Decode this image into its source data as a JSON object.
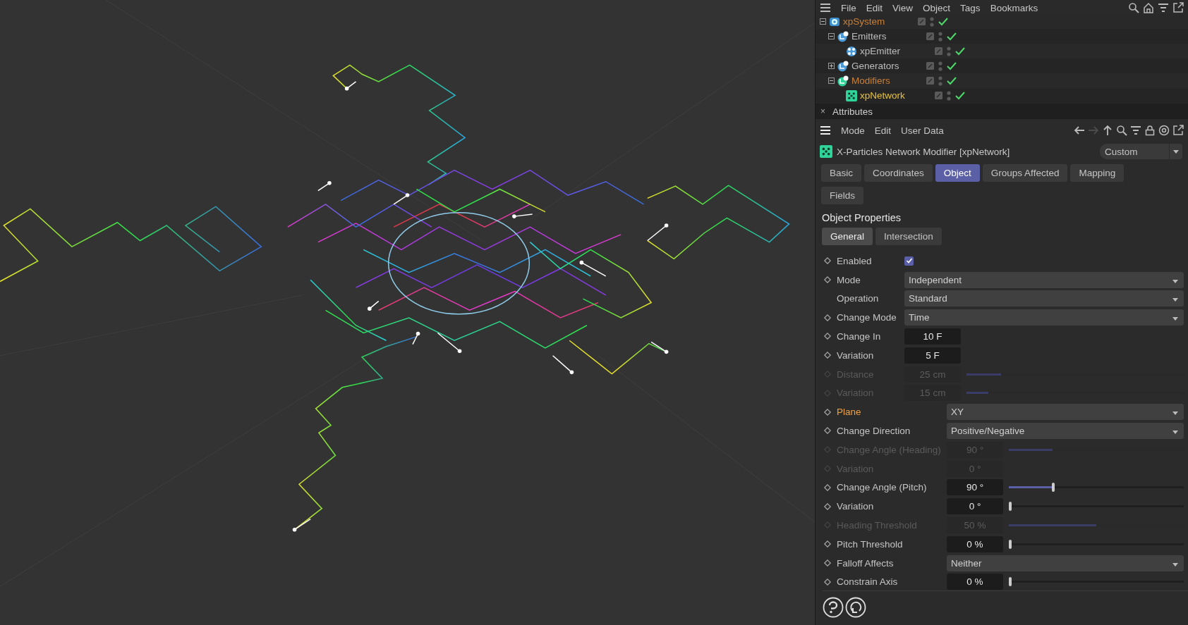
{
  "object_manager": {
    "menu": [
      "File",
      "Edit",
      "View",
      "Object",
      "Tags",
      "Bookmarks"
    ],
    "tree": [
      {
        "name": "xpSystem",
        "kind": "system",
        "color": "#c8803a",
        "expanded": true,
        "enabled": true,
        "children": [
          {
            "name": "Emitters",
            "kind": "group",
            "color": "#bdbdbd",
            "expanded": true,
            "enabled": true,
            "children": [
              {
                "name": "xpEmitter",
                "kind": "emitter",
                "color": "#bdbdbd",
                "enabled": true
              }
            ]
          },
          {
            "name": "Generators",
            "kind": "group",
            "color": "#bdbdbd",
            "expanded": false,
            "enabled": true
          },
          {
            "name": "Modifiers",
            "kind": "group-active",
            "color": "#c8803a",
            "expanded": true,
            "enabled": true,
            "children": [
              {
                "name": "xpNetwork",
                "kind": "network",
                "color": "#e8c23c",
                "enabled": true
              }
            ]
          }
        ]
      }
    ]
  },
  "attributes": {
    "close": "×",
    "title": "Attributes",
    "menu": [
      "Mode",
      "Edit",
      "User Data"
    ],
    "object_title": "X-Particles Network Modifier [xpNetwork]",
    "preset": "Custom",
    "tabs": [
      {
        "label": "Basic",
        "selected": false
      },
      {
        "label": "Coordinates",
        "selected": false
      },
      {
        "label": "Object",
        "selected": true
      },
      {
        "label": "Groups Affected",
        "selected": false
      },
      {
        "label": "Mapping",
        "selected": false
      },
      {
        "label": "Fields",
        "selected": false
      }
    ],
    "section": "Object Properties",
    "subtabs": [
      {
        "label": "General",
        "selected": true
      },
      {
        "label": "Intersection",
        "selected": false
      }
    ],
    "groups": [
      {
        "params": [
          {
            "label": "Enabled",
            "kind": "checkbox",
            "checked": true,
            "keyframe": true,
            "disabled": false,
            "modified": false
          },
          {
            "label": "Mode",
            "kind": "dropdown",
            "value": "Independent",
            "keyframe": true,
            "disabled": false,
            "modified": false
          },
          {
            "label": "Operation",
            "kind": "dropdown",
            "value": "Standard",
            "keyframe": false,
            "disabled": false,
            "modified": false
          },
          {
            "label": "Change Mode",
            "kind": "dropdown",
            "value": "Time",
            "keyframe": true,
            "disabled": false,
            "modified": false
          },
          {
            "label": "Change In",
            "kind": "number",
            "value": "10 F",
            "keyframe": true,
            "disabled": false,
            "modified": false
          },
          {
            "label": "Variation",
            "kind": "number",
            "value": "5 F",
            "keyframe": true,
            "disabled": false,
            "modified": false
          },
          {
            "label": "Distance",
            "kind": "slider",
            "value": "25 cm",
            "level": 0.16,
            "keyframe": true,
            "disabled": true,
            "modified": false
          },
          {
            "label": "Variation",
            "kind": "slider",
            "value": "15 cm",
            "level": 0.1,
            "keyframe": true,
            "disabled": true,
            "modified": false
          }
        ]
      },
      {
        "params": [
          {
            "label": "Plane",
            "kind": "dropdown",
            "value": "XY",
            "keyframe": true,
            "disabled": false,
            "modified": true
          },
          {
            "label": "Change Direction",
            "kind": "dropdown",
            "value": "Positive/Negative",
            "keyframe": true,
            "disabled": false,
            "modified": false
          },
          {
            "label": "Change Angle (Heading)",
            "kind": "slider",
            "value": "90 °",
            "level": 0.25,
            "keyframe": true,
            "disabled": true,
            "modified": false
          },
          {
            "label": "Variation",
            "kind": "number",
            "value": "0 °",
            "keyframe": true,
            "disabled": true,
            "modified": false
          },
          {
            "label": "Change Angle (Pitch)",
            "kind": "slider",
            "value": "90 °",
            "level": 0.25,
            "keyframe": true,
            "disabled": false,
            "modified": false
          },
          {
            "label": "Variation",
            "kind": "slider",
            "value": "0 °",
            "level": 0,
            "keyframe": true,
            "disabled": false,
            "modified": false
          },
          {
            "label": "Heading Threshold",
            "kind": "slider",
            "value": "50 %",
            "level": 0.5,
            "keyframe": true,
            "disabled": true,
            "modified": false
          },
          {
            "label": "Pitch Threshold",
            "kind": "slider",
            "value": "0 %",
            "level": 0,
            "keyframe": true,
            "disabled": false,
            "modified": false
          },
          {
            "label": "Falloff Affects",
            "kind": "dropdown",
            "value": "Neither",
            "keyframe": true,
            "disabled": false,
            "modified": false
          },
          {
            "label": "Constrain Axis",
            "kind": "slider",
            "value": "0 %",
            "level": 0,
            "keyframe": true,
            "disabled": false,
            "modified": false
          }
        ]
      }
    ]
  }
}
